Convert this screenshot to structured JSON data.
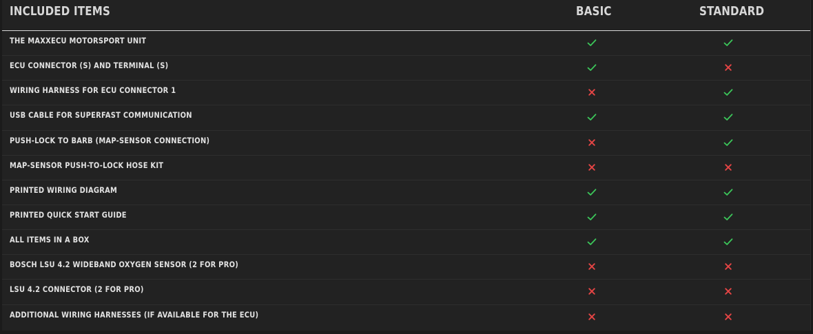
{
  "header": {
    "items_label": "INCLUDED ITEMS",
    "basic_label": "BASIC",
    "standard_label": "STANDARD"
  },
  "colors": {
    "check": "#3cc75a",
    "cross": "#e64545",
    "background": "#222222",
    "text": "#e2e2e2"
  },
  "rows": [
    {
      "label": "THE MAXXECU MOTORSPORT UNIT",
      "basic": "check",
      "standard": "check"
    },
    {
      "label": "ECU CONNECTOR (S) AND TERMINAL (S)",
      "basic": "check",
      "standard": "cross"
    },
    {
      "label": "WIRING HARNESS FOR ECU CONNECTOR 1",
      "basic": "cross",
      "standard": "check"
    },
    {
      "label": "USB CABLE FOR SUPERFAST COMMUNICATION",
      "basic": "check",
      "standard": "check"
    },
    {
      "label": "PUSH-LOCK TO BARB (MAP-SENSOR CONNECTION)",
      "basic": "cross",
      "standard": "check"
    },
    {
      "label": "MAP-SENSOR PUSH-TO-LOCK HOSE KIT",
      "basic": "cross",
      "standard": "cross"
    },
    {
      "label": "PRINTED WIRING DIAGRAM",
      "basic": "check",
      "standard": "check"
    },
    {
      "label": "PRINTED QUICK START GUIDE",
      "basic": "check",
      "standard": "check"
    },
    {
      "label": "ALL ITEMS IN A BOX",
      "basic": "check",
      "standard": "check"
    },
    {
      "label": "BOSCH LSU 4.2 WIDEBAND OXYGEN SENSOR (2 FOR PRO)",
      "basic": "cross",
      "standard": "cross"
    },
    {
      "label": "LSU 4.2 CONNECTOR (2 FOR PRO)",
      "basic": "cross",
      "standard": "cross"
    },
    {
      "label": "ADDITIONAL WIRING HARNESSES (IF AVAILABLE FOR THE ECU)",
      "basic": "cross",
      "standard": "cross"
    }
  ]
}
